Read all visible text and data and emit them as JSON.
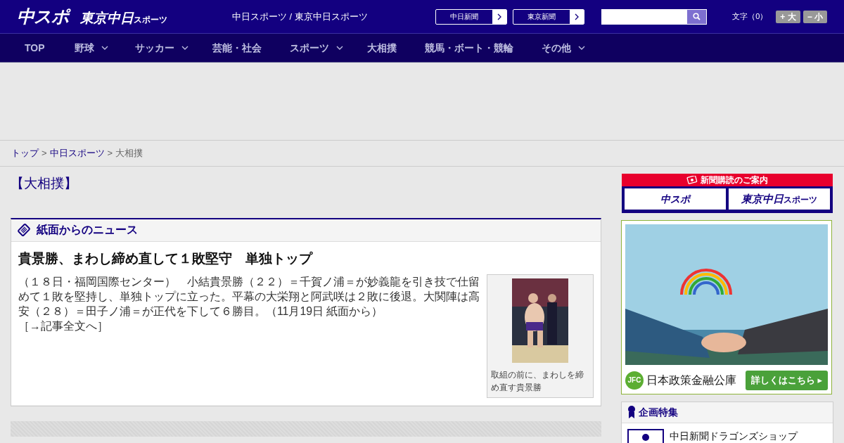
{
  "header": {
    "logo_main": "中スポ",
    "logo_sub": "東京中日",
    "logo_sub_small": "スポーツ",
    "tagline": "中日スポーツ / 東京中日スポーツ",
    "paper_links": [
      {
        "label": "中日新聞"
      },
      {
        "label": "東京新聞"
      }
    ],
    "font_size": {
      "label": "文字（0）",
      "buttons": [
        "+ 大",
        "− 小"
      ]
    }
  },
  "nav": [
    {
      "label": "TOP",
      "has_menu": false
    },
    {
      "label": "野球",
      "has_menu": true
    },
    {
      "label": "サッカー",
      "has_menu": true
    },
    {
      "label": "芸能・社会",
      "has_menu": false
    },
    {
      "label": "スポーツ",
      "has_menu": true
    },
    {
      "label": "大相撲",
      "has_menu": false
    },
    {
      "label": "競馬・ボート・競輪",
      "has_menu": false
    },
    {
      "label": "その他",
      "has_menu": true
    }
  ],
  "breadcrumb": [
    {
      "kind": "link",
      "label": "トップ"
    },
    {
      "kind": "separator",
      "label": ">"
    },
    {
      "kind": "link",
      "label": "中日スポーツ"
    },
    {
      "kind": "separator",
      "label": ">"
    },
    {
      "kind": "current",
      "label": "大相撲"
    }
  ],
  "page_title": "【大相撲】",
  "news": {
    "heading": "紙面からのニュース",
    "headline": "貴景勝、まわし締め直して１敗堅守　単独トップ",
    "body": "（１８日・福岡国際センター）　小結貴景勝（２２）＝千賀ノ浦＝が妙義龍を引き技で仕留めて１敗を堅持し、単独トップに立った。平幕の大栄翔と阿武咲は２敗に後退。大関陣は高安（２８）＝田子ノ浦＝が正代を下して６勝目。（11月19日 紙面から）",
    "more_link": "［→記事全文へ］",
    "photo": {
      "kind": "picture",
      "caption": "取組の前に、まわしを締め直す貴景勝"
    }
  },
  "sidebar": {
    "subscribe": {
      "title": "新聞購読のご案内",
      "logo_main": "中スポ",
      "logo_sub": "東京中日",
      "logo_sub_small": "スポーツ"
    },
    "ad": {
      "badge": "JFC",
      "advertiser": "日本政策金融公庫",
      "cta": "詳しくはこちら ▸"
    },
    "features": {
      "title": "企画特集",
      "items": [
        {
          "label": "中日新聞ドラゴンズショップ"
        }
      ]
    }
  }
}
